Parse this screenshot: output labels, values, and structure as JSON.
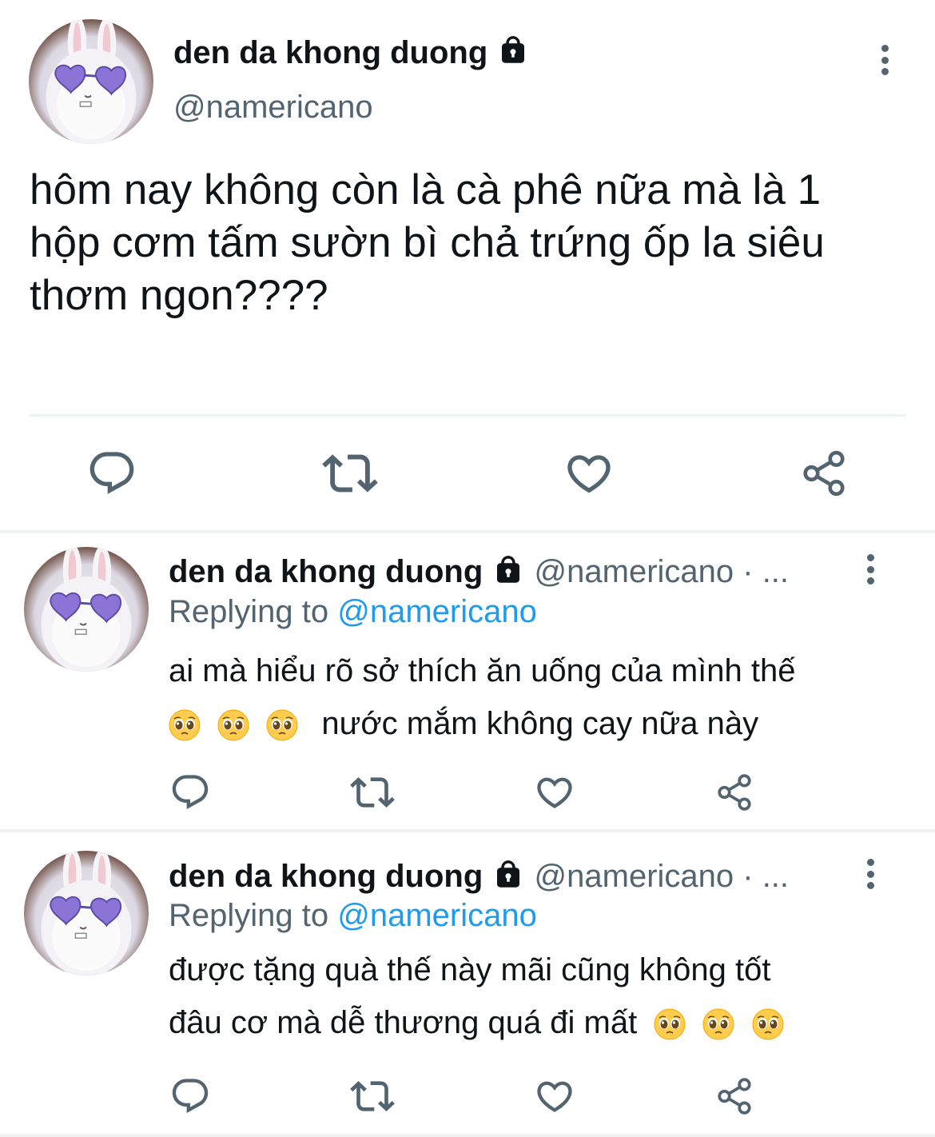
{
  "main_tweet": {
    "display_name": "den da khong duong",
    "handle": "@namericano",
    "text_lines": [
      "hôm nay không còn là cà phê nữa mà là 1",
      "hộp cơm tấm sườn bì chả trứng ốp la siêu",
      "thơm ngon????"
    ],
    "icons": {
      "lock": "lock-icon",
      "more": "more-vertical-icon",
      "reply": "reply-icon",
      "retweet": "retweet-icon",
      "like": "heart-icon",
      "share": "share-icon"
    }
  },
  "replies": [
    {
      "display_name": "den da khong duong",
      "handle_meta": "@namericano · ...",
      "replying_prefix": "Replying to",
      "replying_to": "@namericano",
      "text_line1": "ai mà hiểu rõ sở thích ăn uống của mình thế",
      "text_line2": "nước mắm không cay nữa này",
      "emoji": "pleading-face-emoji"
    },
    {
      "display_name": "den da khong duong",
      "handle_meta": "@namericano · ...",
      "replying_prefix": "Replying to",
      "replying_to": "@namericano",
      "text_line1": "được tặng quà thế này mãi cũng không tốt",
      "text_line2": "đâu cơ mà dễ thương quá đi mất",
      "emoji": "pleading-face-emoji"
    }
  ],
  "colors": {
    "text": "#0f1419",
    "secondary": "#536471",
    "link": "#1d9bf0",
    "divider": "#eff3f4",
    "lens": "#8b74d6"
  }
}
